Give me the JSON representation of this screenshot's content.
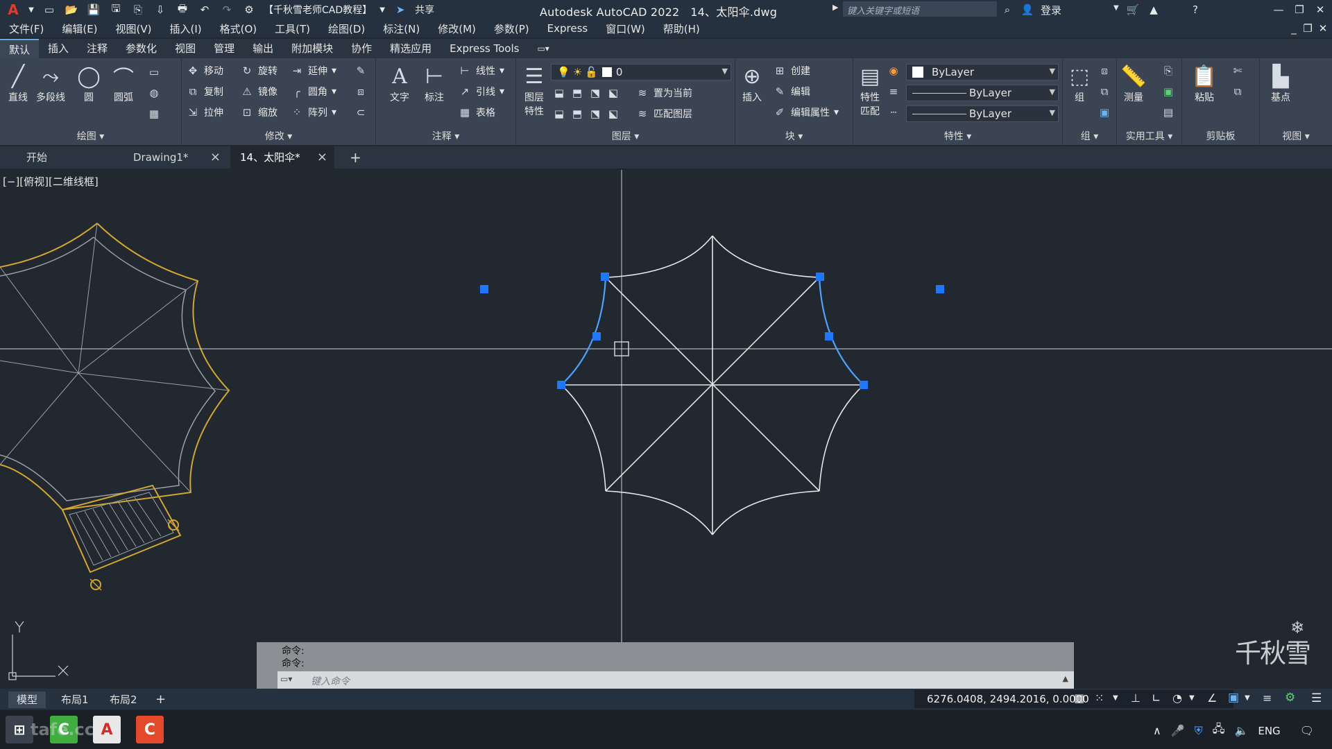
{
  "titlebar": {
    "app_title": "Autodesk AutoCAD 2022",
    "file_name": "14、太阳伞.dwg",
    "workspace": "【千秋雪老师CAD教程】",
    "share_label": "共享",
    "search_placeholder": "键入关键字或短语",
    "login_label": "登录"
  },
  "menubar": [
    "文件(F)",
    "编辑(E)",
    "视图(V)",
    "插入(I)",
    "格式(O)",
    "工具(T)",
    "绘图(D)",
    "标注(N)",
    "修改(M)",
    "参数(P)",
    "Express",
    "窗口(W)",
    "帮助(H)"
  ],
  "ribbon_tabs": [
    "默认",
    "插入",
    "注释",
    "参数化",
    "视图",
    "管理",
    "输出",
    "附加模块",
    "协作",
    "精选应用",
    "Express Tools"
  ],
  "ribbon": {
    "draw": {
      "title": "绘图",
      "line": "直线",
      "polyline": "多段线",
      "circle": "圆",
      "arc": "圆弧"
    },
    "modify": {
      "title": "修改",
      "move": "移动",
      "rotate": "旋转",
      "extend": "延伸",
      "copy": "复制",
      "mirror": "镜像",
      "fillet": "圆角",
      "stretch": "拉伸",
      "scale": "缩放",
      "array": "阵列"
    },
    "annotation": {
      "title": "注释",
      "text": "文字",
      "dimension": "标注",
      "linear": "线性",
      "leader": "引线",
      "table": "表格"
    },
    "layers": {
      "title": "图层",
      "props_line1": "图层",
      "props_line2": "特性",
      "current_layer": "0",
      "make_current": "置为当前",
      "match_layer": "匹配图层"
    },
    "block": {
      "title": "块",
      "insert": "插入",
      "create": "创建",
      "edit": "编辑",
      "edit_attr": "编辑属性"
    },
    "properties": {
      "title": "特性",
      "match_line1": "特性",
      "match_line2": "匹配",
      "color": "ByLayer",
      "linetype": "ByLayer",
      "lineweight": "ByLayer"
    },
    "groups": {
      "title": "组",
      "group": "组"
    },
    "utilities": {
      "title": "实用工具",
      "measure": "测量"
    },
    "clipboard": {
      "title": "剪贴板",
      "paste": "粘贴"
    },
    "view": {
      "title": "视图",
      "base": "基点"
    }
  },
  "doc_tabs": [
    {
      "label": "开始"
    },
    {
      "label": "Drawing1*"
    },
    {
      "label": "14、太阳伞*"
    }
  ],
  "canvas": {
    "view_label": "[−][俯视][二维线框]",
    "ucs_x": "X",
    "ucs_y": "Y",
    "watermark": "千秋雪"
  },
  "command_line": {
    "history": [
      "命令:",
      "命令:"
    ],
    "placeholder": "键入命令"
  },
  "layout_tabs": [
    "模型",
    "布局1",
    "布局2"
  ],
  "status": {
    "coordinates": "6276.0408, 2494.2016, 0.0000"
  },
  "taskbar": {
    "language": "ENG",
    "watermark": "tafe.cc"
  },
  "colors": {
    "canvas_bg": "#212830",
    "accent_yellow": "#d4a72c",
    "grip_blue": "#1e78ff",
    "selection_blue": "#4aa3ff"
  }
}
